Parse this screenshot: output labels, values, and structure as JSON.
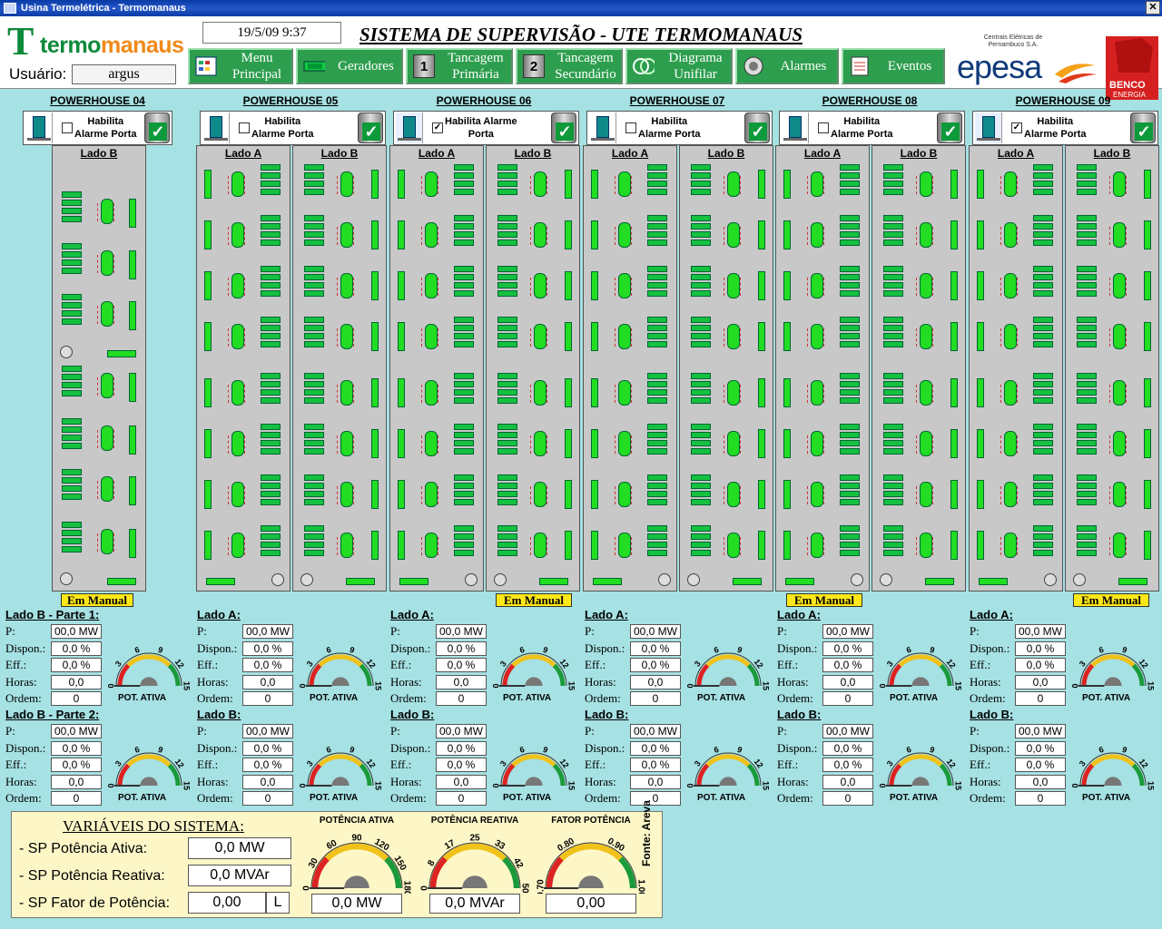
{
  "window": {
    "title": "Usina Termelétrica - Termomanaus"
  },
  "header": {
    "logo_left": [
      "termo",
      "manaus"
    ],
    "user_label": "Usuário:",
    "user_value": "argus",
    "datetime": "19/5/09 9:37",
    "title": "SISTEMA DE SUPERVISÃO - UTE TERMOMANAUS",
    "nav": [
      {
        "label1": "Menu",
        "label2": "Principal"
      },
      {
        "label1": "Geradores",
        "label2": ""
      },
      {
        "label1": "Tancagem",
        "label2": "Primária",
        "num": "1"
      },
      {
        "label1": "Tancagem",
        "label2": "Secundário",
        "num": "2"
      },
      {
        "label1": "Diagrama",
        "label2": "Unifilar"
      },
      {
        "label1": "Alarmes",
        "label2": ""
      },
      {
        "label1": "Eventos",
        "label2": ""
      }
    ],
    "epesa_small": "Centrais Elétricas de Pernambuco S.A.",
    "epesa": "epesa",
    "benco": [
      "BENCO",
      "ENERGIA"
    ]
  },
  "powerhouses": [
    {
      "name": "POWERHOUSE 04",
      "hab1": "Habilita",
      "hab2": "Alarme Porta",
      "checked": "",
      "sides": [
        "Lado B"
      ],
      "manual": "Em Manual"
    },
    {
      "name": "POWERHOUSE 05",
      "hab1": "Habilita",
      "hab2": "Alarme Porta",
      "checked": "",
      "sides": [
        "Lado A",
        "Lado B"
      ],
      "manual": ""
    },
    {
      "name": "POWERHOUSE 06",
      "hab1": "Habilita Alarme",
      "hab2": "Porta",
      "checked": "✓",
      "sides": [
        "Lado A",
        "Lado B"
      ],
      "manual": "Em Manual"
    },
    {
      "name": "POWERHOUSE 07",
      "hab1": "Habilita",
      "hab2": "Alarme Porta",
      "checked": "",
      "sides": [
        "Lado A",
        "Lado B"
      ],
      "manual": ""
    },
    {
      "name": "POWERHOUSE 08",
      "hab1": "Habilita",
      "hab2": "Alarme Porta",
      "checked": "",
      "sides": [
        "Lado A",
        "Lado B"
      ],
      "manual": "Em Manual"
    },
    {
      "name": "POWERHOUSE 09",
      "hab1": "Habilita",
      "hab2": "Alarme Porta",
      "checked": "✓",
      "sides": [
        "Lado A",
        "Lado B"
      ],
      "manual": "Em Manual"
    }
  ],
  "stats_labels": {
    "p": "P:",
    "dispon": "Dispon.:",
    "eff": "Eff.:",
    "horas": "Horas:",
    "ordem": "Ordem:",
    "pot": "POT. ATIVA"
  },
  "stats_values": {
    "p": "00,0 MW",
    "dispon": "0,0 %",
    "eff": "0,0 %",
    "horas": "0,0",
    "ordem": "0"
  },
  "stats_blocks": [
    [
      "Lado B - Parte 1:",
      "Lado B - Parte 2:"
    ],
    [
      "Lado A:",
      "Lado B:"
    ],
    [
      "Lado A:",
      "Lado B:"
    ],
    [
      "Lado A:",
      "Lado B:"
    ],
    [
      "Lado A:",
      "Lado B:"
    ],
    [
      "Lado A:",
      "Lado B:"
    ]
  ],
  "gauge_ticks": [
    "0",
    "3",
    "6",
    "9",
    "12",
    "15"
  ],
  "system": {
    "title": "VARIÁVEIS DO SISTEMA:",
    "rows": [
      {
        "label": "- SP Potência Ativa:",
        "value": "0,0 MW"
      },
      {
        "label": "- SP Potência Reativa:",
        "value": "0,0 MVAr"
      },
      {
        "label": "- SP Fator de Potência:",
        "value": "0,00",
        "extra": "L"
      }
    ],
    "gauges": [
      {
        "title": "POTÊNCIA ATIVA",
        "value": "0,0 MW",
        "ticks": [
          "0",
          "30",
          "60",
          "90",
          "120",
          "150",
          "180"
        ]
      },
      {
        "title": "POTÊNCIA REATIVA",
        "value": "0,0 MVAr",
        "ticks": [
          "0",
          "8",
          "17",
          "25",
          "33",
          "42",
          "50"
        ]
      },
      {
        "title": "FATOR POTÊNCIA",
        "value": "0,00",
        "ticks": [
          "0.70",
          "0.80",
          "0.90",
          "1.00"
        ]
      }
    ],
    "fonte": "Fonte: Areva"
  }
}
